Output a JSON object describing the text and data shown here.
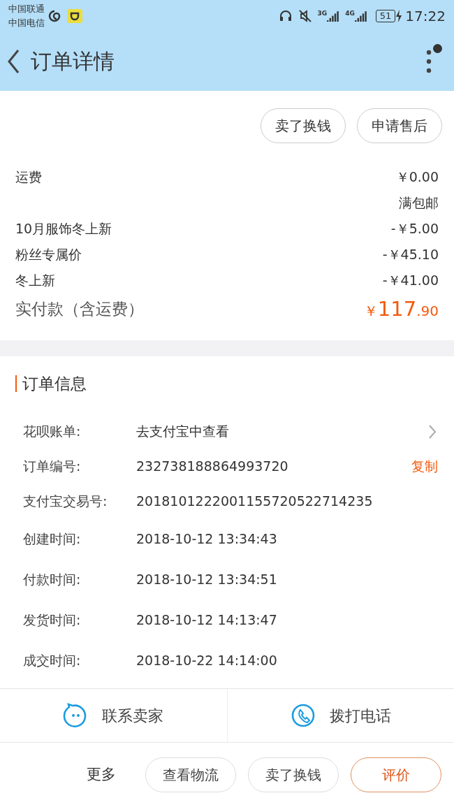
{
  "status_bar": {
    "carriers": [
      "中国联通",
      "中国电信"
    ],
    "network_labels": [
      "3G",
      "4G"
    ],
    "battery": "51",
    "time": "17:22"
  },
  "header": {
    "title": "订单详情",
    "notification_dot": true
  },
  "top_actions": [
    "卖了换钱",
    "申请售后"
  ],
  "price_lines": [
    {
      "kind": "line",
      "label": "运费",
      "value": "￥0.00"
    },
    {
      "kind": "note",
      "value": "满包邮"
    },
    {
      "kind": "line",
      "label": "10月服饰冬上新",
      "value": "-￥5.00"
    },
    {
      "kind": "line",
      "label": "粉丝专属价",
      "value": "-￥45.10"
    },
    {
      "kind": "line",
      "label": "冬上新",
      "value": "-￥41.00"
    }
  ],
  "total": {
    "label": "实付款（含运费）",
    "currency": "￥",
    "integer": "117",
    "decimal": ".90"
  },
  "order_info": {
    "title": "订单信息",
    "rows": [
      {
        "kind": "link",
        "label": "花呗账单:",
        "value": "去支付宝中查看"
      },
      {
        "kind": "copy",
        "label": "订单编号:",
        "value": "232738188864993720",
        "action": "复制"
      },
      {
        "kind": "plain",
        "label": "支付宝交易号:",
        "value": "2018101222001155720522714235"
      },
      {
        "kind": "plain",
        "label": "创建时间:",
        "value": "2018-10-12 13:34:43"
      },
      {
        "kind": "plain",
        "label": "付款时间:",
        "value": "2018-10-12 13:34:51"
      },
      {
        "kind": "plain",
        "label": "发货时间:",
        "value": "2018-10-12 14:13:47"
      },
      {
        "kind": "plain",
        "label": "成交时间:",
        "value": "2018-10-22 14:14:00"
      }
    ]
  },
  "contact": [
    {
      "kind": "chat",
      "label": "联系卖家"
    },
    {
      "kind": "phone",
      "label": "拨打电话"
    }
  ],
  "bottom_bar": {
    "more": "更多",
    "buttons": [
      {
        "label": "查看物流",
        "primary": false
      },
      {
        "label": "卖了换钱",
        "primary": false
      },
      {
        "label": "评价",
        "primary": true
      }
    ]
  }
}
